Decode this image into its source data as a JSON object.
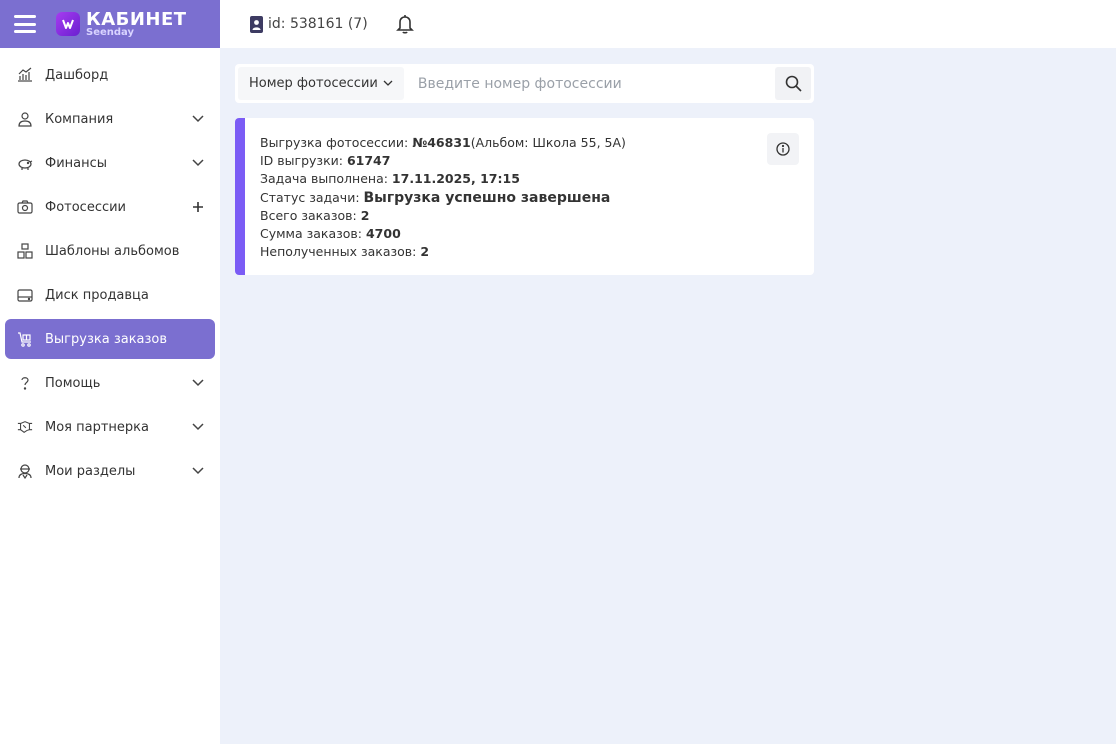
{
  "brand": {
    "title": "КАБИНЕТ",
    "subtitle": "Seenday",
    "accent": "#7b6fd0"
  },
  "topbar": {
    "user_id": "id: 538161 (7)",
    "icons": [
      "id-badge-icon",
      "bell-icon"
    ]
  },
  "sidebar": {
    "items": [
      {
        "label": "Дашборд",
        "icon": "chart-icon"
      },
      {
        "label": "Компания",
        "icon": "company-icon",
        "expandable": true
      },
      {
        "label": "Финансы",
        "icon": "piggy-bank-icon",
        "expandable": true
      },
      {
        "label": "Фотосессии",
        "icon": "camera-icon",
        "addable": true
      },
      {
        "label": "Шаблоны альбомов",
        "icon": "boxes-icon"
      },
      {
        "label": "Диск продавца",
        "icon": "disk-icon"
      },
      {
        "label": "Выгрузка заказов",
        "icon": "cart-export-icon",
        "active": true
      },
      {
        "label": "Помощь",
        "icon": "question-icon",
        "expandable": true
      },
      {
        "label": "Моя партнерка",
        "icon": "handshake-icon",
        "expandable": true
      },
      {
        "label": "Мои разделы",
        "icon": "user-section-icon",
        "expandable": true
      }
    ]
  },
  "search": {
    "select_label": "Номер фотосессии",
    "placeholder": "Введите номер фотосессии",
    "value": ""
  },
  "card": {
    "session_label": "Выгрузка фотосессии: ",
    "session_number": "№46831",
    "session_album": "(Альбом: Школа 55, 5А)",
    "export_id_label": "ID выгрузки: ",
    "export_id": "61747",
    "done_label": "Задача выполнена: ",
    "done_value": "17.11.2025, 17:15",
    "status_label": "Статус задачи: ",
    "status_value": "Выгрузка успешно завершена",
    "total_label": "Всего заказов: ",
    "total_value": "2",
    "sum_label": "Сумма заказов: ",
    "sum_value": "4700",
    "unreceived_label": "Неполученных заказов: ",
    "unreceived_value": "2",
    "stripe_color": "#7b5cf5"
  }
}
